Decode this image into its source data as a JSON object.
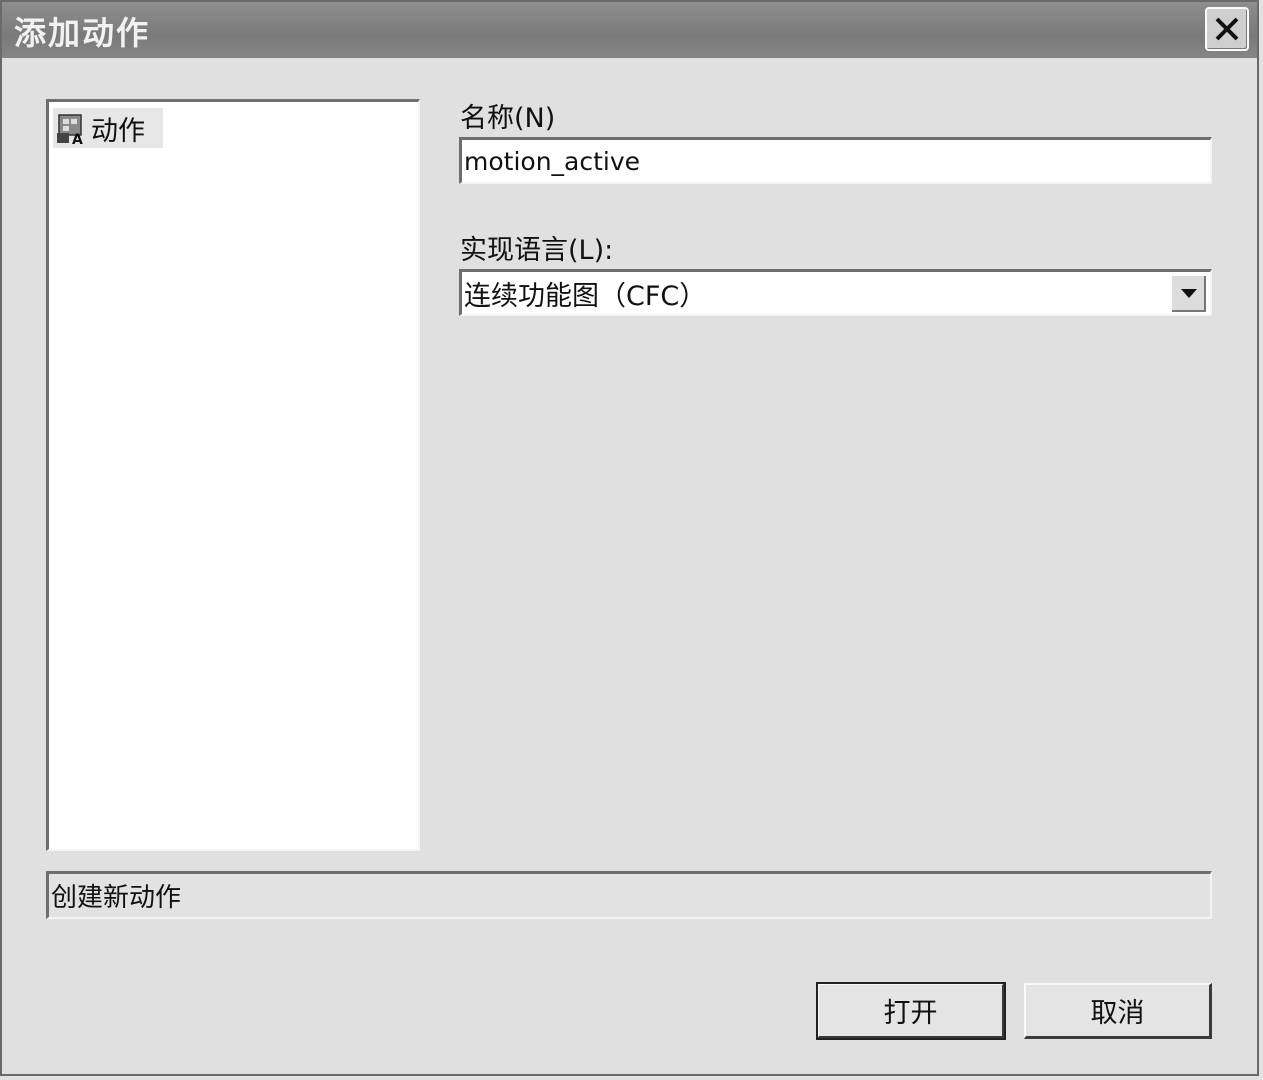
{
  "window": {
    "title": "添加动作"
  },
  "tree": {
    "items": [
      {
        "label": "动作",
        "icon": "action-tree-icon"
      }
    ]
  },
  "form": {
    "name_label": "名称(N)",
    "name_value": "motion_active",
    "language_label": "实现语言(L):",
    "language_value": "连续功能图（CFC）"
  },
  "status": {
    "text": "创建新动作"
  },
  "buttons": {
    "open": "打开",
    "cancel": "取消"
  }
}
